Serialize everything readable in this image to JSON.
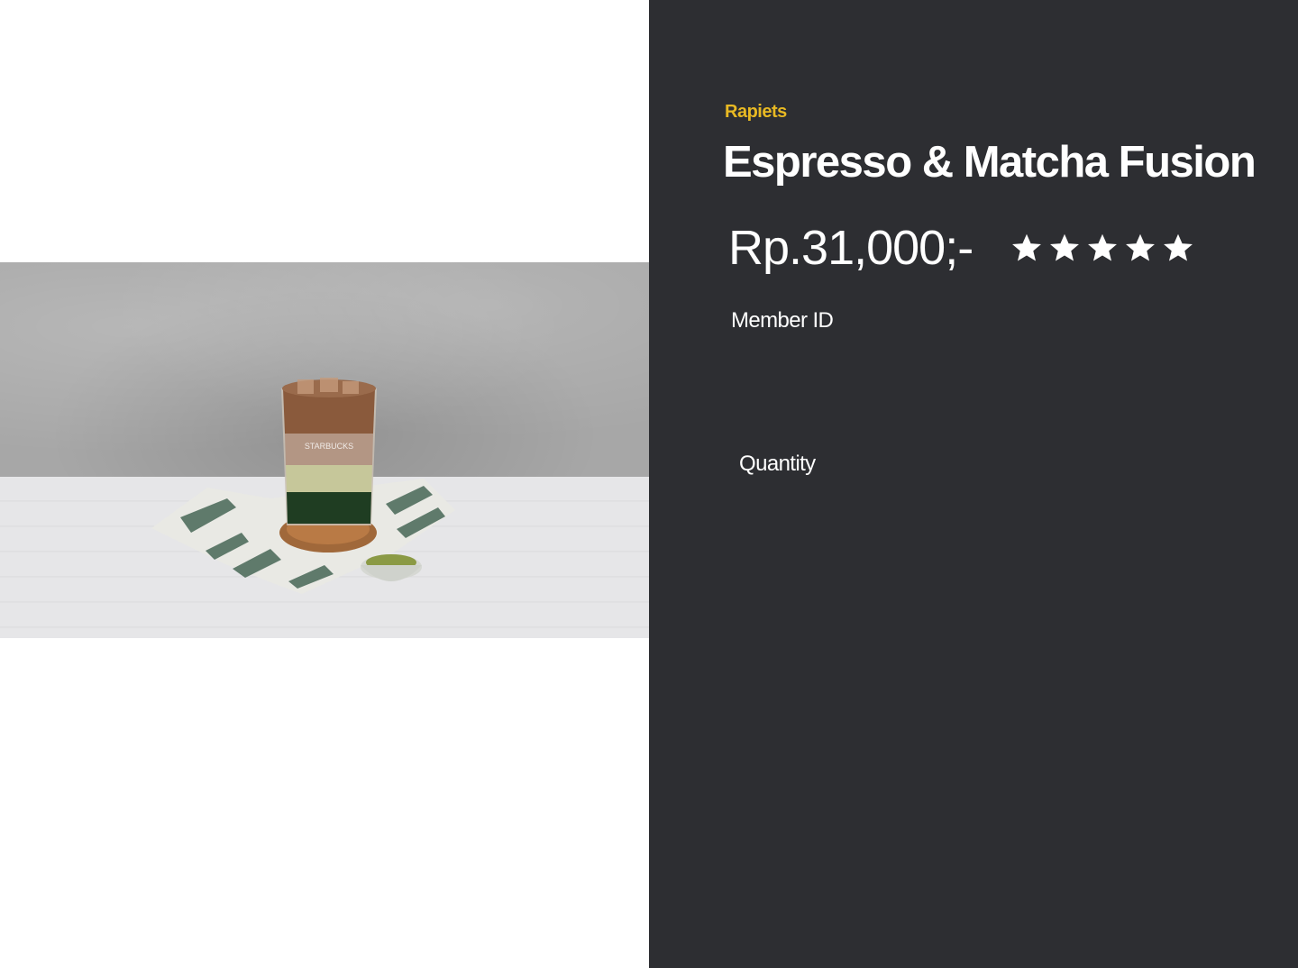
{
  "product": {
    "brand": "Rapiets",
    "title": "Espresso & Matcha Fusion",
    "price": "Rp.31,000;-",
    "rating": 5,
    "rating_max": 5,
    "image_alt": "Espresso & Matcha Fusion iced drink"
  },
  "form": {
    "member_id_label": "Member ID",
    "quantity_label": "Quantity"
  },
  "colors": {
    "panel_background": "#2d2e32",
    "brand_accent": "#e8b923",
    "text": "#ffffff",
    "star": "#ffffff"
  },
  "icons": {
    "rating_star": "star-icon"
  }
}
